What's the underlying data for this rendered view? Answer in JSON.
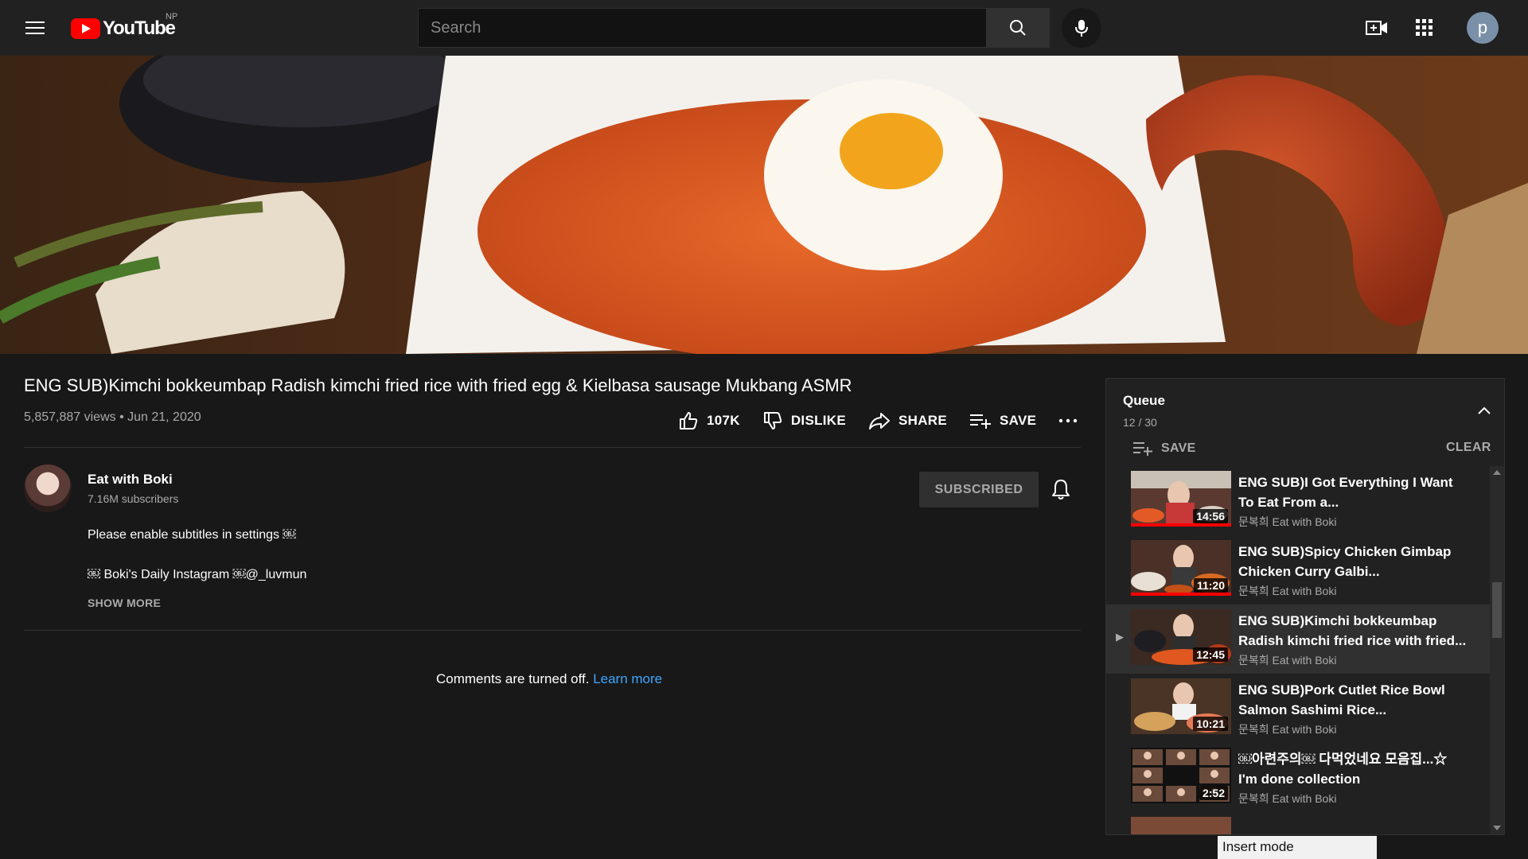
{
  "header": {
    "logo_text": "YouTube",
    "region": "NP",
    "search_placeholder": "Search",
    "avatar_letter": "p"
  },
  "video": {
    "title": "ENG SUB)Kimchi bokkeumbap Radish kimchi fried rice with fried egg & Kielbasa sausage Mukbang ASMR",
    "views_date": "5,857,887 views • Jun 21, 2020",
    "like_count": "107K",
    "dislike_label": "DISLIKE",
    "share_label": "SHARE",
    "save_label": "SAVE"
  },
  "channel": {
    "name": "Eat with Boki",
    "subscribers": "7.16M subscribers",
    "subscribed_label": "SUBSCRIBED"
  },
  "description": {
    "line1": "Please enable subtitles in settings ￼",
    "line2": "￼ Boki's Daily Instagram ￼@_luvmun",
    "show_more": "SHOW MORE"
  },
  "comments": {
    "text": "Comments are turned off.",
    "link": "Learn more"
  },
  "queue": {
    "heading": "Queue",
    "count": "12 / 30",
    "save_label": "SAVE",
    "clear_label": "CLEAR",
    "items": [
      {
        "title": "ENG SUB)I Got Everything I Want To Eat From a...",
        "channel": "문복희 Eat with Boki",
        "duration": "14:56",
        "progress": 1.0,
        "active": false
      },
      {
        "title": "ENG SUB)Spicy Chicken Gimbap Chicken Curry Galbi...",
        "channel": "문복희 Eat with Boki",
        "duration": "11:20",
        "progress": 1.0,
        "active": false
      },
      {
        "title": "ENG SUB)Kimchi bokkeumbap Radish kimchi fried rice with fried...",
        "channel": "문복희 Eat with Boki",
        "duration": "12:45",
        "progress": 0,
        "active": true
      },
      {
        "title": "ENG SUB)Pork Cutlet Rice Bowl Salmon Sashimi Rice...",
        "channel": "문복희 Eat with Boki",
        "duration": "10:21",
        "progress": 0,
        "active": false
      },
      {
        "title": "￼아련주의￼ 다먹었네요 모음집...☆ I'm done collection",
        "channel": "문복희 Eat with Boki",
        "duration": "2:52",
        "progress": 0,
        "active": false
      }
    ]
  },
  "status": {
    "insert_mode": "Insert mode"
  }
}
